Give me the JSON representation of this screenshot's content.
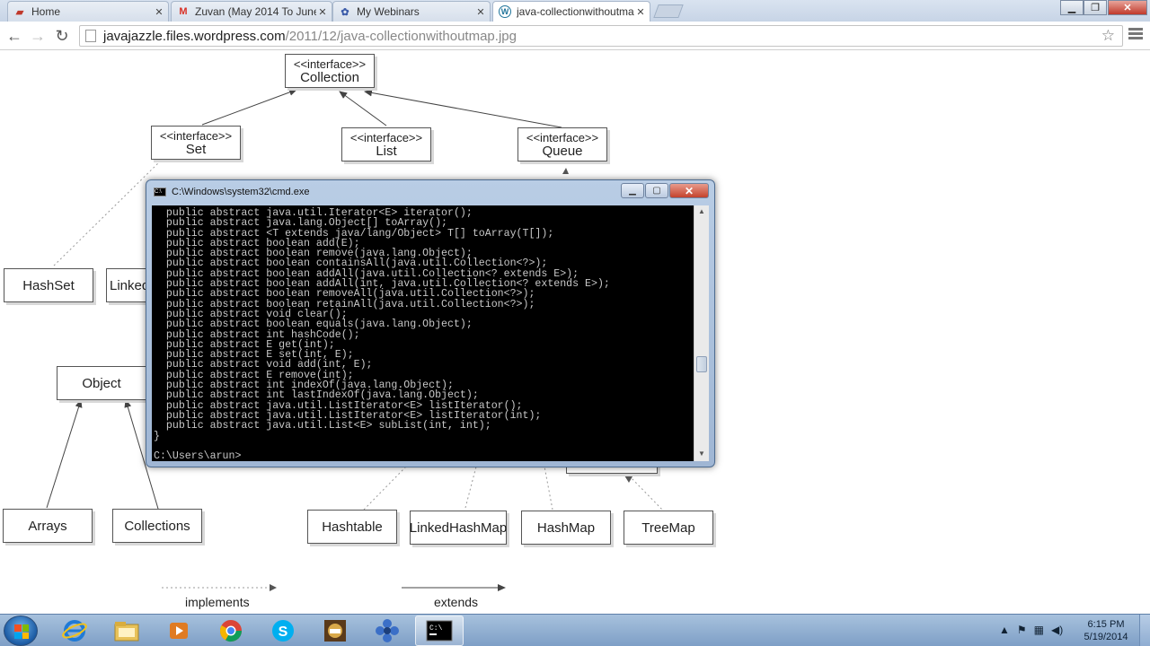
{
  "browser": {
    "tabs": [
      {
        "label": "Home",
        "icon": "slides-icon"
      },
      {
        "label": "Zuvan (May 2014 To June",
        "icon": "gmail-icon"
      },
      {
        "label": "My Webinars",
        "icon": "webinar-icon"
      },
      {
        "label": "java-collectionwithoutma",
        "icon": "wordpress-icon"
      }
    ],
    "url_host": "javajazzle.files.wordpress.com",
    "url_path": "/2011/12/java-collectionwithoutmap.jpg"
  },
  "diagram": {
    "collection": {
      "stereotype": "<<interface>>",
      "name": "Collection"
    },
    "set": {
      "stereotype": "<<interface>>",
      "name": "Set"
    },
    "list": {
      "stereotype": "<<interface>>",
      "name": "List"
    },
    "queue": {
      "stereotype": "<<interface>>",
      "name": "Queue"
    },
    "hashset": "HashSet",
    "linked": "Linked",
    "object": "Object",
    "arrays": "Arrays",
    "collections": "Collections",
    "hashtable": "Hashtable",
    "linkedhashmap": "LinkedHashMap",
    "hashmap": "HashMap",
    "treemap": "TreeMap",
    "legend_implements": "implements",
    "legend_extends": "extends"
  },
  "cmd": {
    "title": "C:\\Windows\\system32\\cmd.exe",
    "lines": [
      "  public abstract java.util.Iterator<E> iterator();",
      "  public abstract java.lang.Object[] toArray();",
      "  public abstract <T extends java/lang/Object> T[] toArray(T[]);",
      "  public abstract boolean add(E);",
      "  public abstract boolean remove(java.lang.Object);",
      "  public abstract boolean containsAll(java.util.Collection<?>);",
      "  public abstract boolean addAll(java.util.Collection<? extends E>);",
      "  public abstract boolean addAll(int, java.util.Collection<? extends E>);",
      "  public abstract boolean removeAll(java.util.Collection<?>);",
      "  public abstract boolean retainAll(java.util.Collection<?>);",
      "  public abstract void clear();",
      "  public abstract boolean equals(java.lang.Object);",
      "  public abstract int hashCode();",
      "  public abstract E get(int);",
      "  public abstract E set(int, E);",
      "  public abstract void add(int, E);",
      "  public abstract E remove(int);",
      "  public abstract int indexOf(java.lang.Object);",
      "  public abstract int lastIndexOf(java.lang.Object);",
      "  public abstract java.util.ListIterator<E> listIterator();",
      "  public abstract java.util.ListIterator<E> listIterator(int);",
      "  public abstract java.util.List<E> subList(int, int);",
      "}",
      "",
      "C:\\Users\\arun>"
    ]
  },
  "taskbar": {
    "apps": [
      "ie-icon",
      "explorer-icon",
      "media-player-icon",
      "chrome-icon",
      "skype-icon",
      "ide-icon",
      "webinar-app-icon",
      "cmd-icon"
    ],
    "time": "6:15 PM",
    "date": "5/19/2014"
  }
}
